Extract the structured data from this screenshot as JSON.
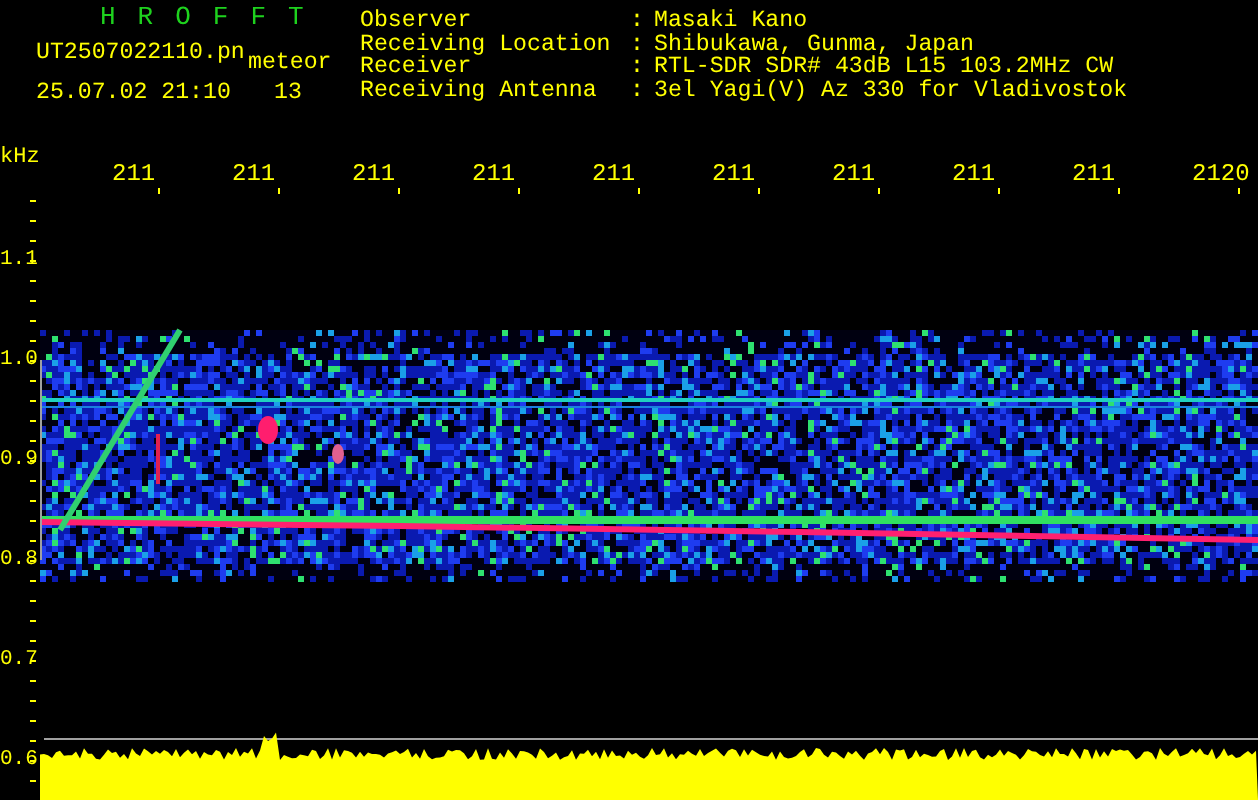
{
  "title": "H R O F F T",
  "file_name": "UT2507022110.pn",
  "meteor_label": "meteor",
  "timestamp": "25.07.02 21:10",
  "count": "13",
  "info": [
    {
      "label": "Observer",
      "separator": ":",
      "value": "Masaki Kano"
    },
    {
      "label": "Receiving Location",
      "separator": ":",
      "value": "Shibukawa, Gunma, Japan"
    },
    {
      "label": "Receiver",
      "separator": ":",
      "value": "RTL-SDR SDR# 43dB L15 103.2MHz CW"
    },
    {
      "label": "Receiving Antenna",
      "separator": ":",
      "value": "3el Yagi(V) Az 330 for Vladivostok"
    }
  ],
  "spectrogram": {
    "y_unit": "kHz",
    "y_ticks": [
      "1.1",
      "1.0",
      "0.9",
      "0.8",
      "0.7",
      "0.6"
    ],
    "x_ticks": [
      "211",
      "211",
      "211",
      "211",
      "211",
      "211",
      "211",
      "211",
      "211",
      "2120"
    ]
  }
}
